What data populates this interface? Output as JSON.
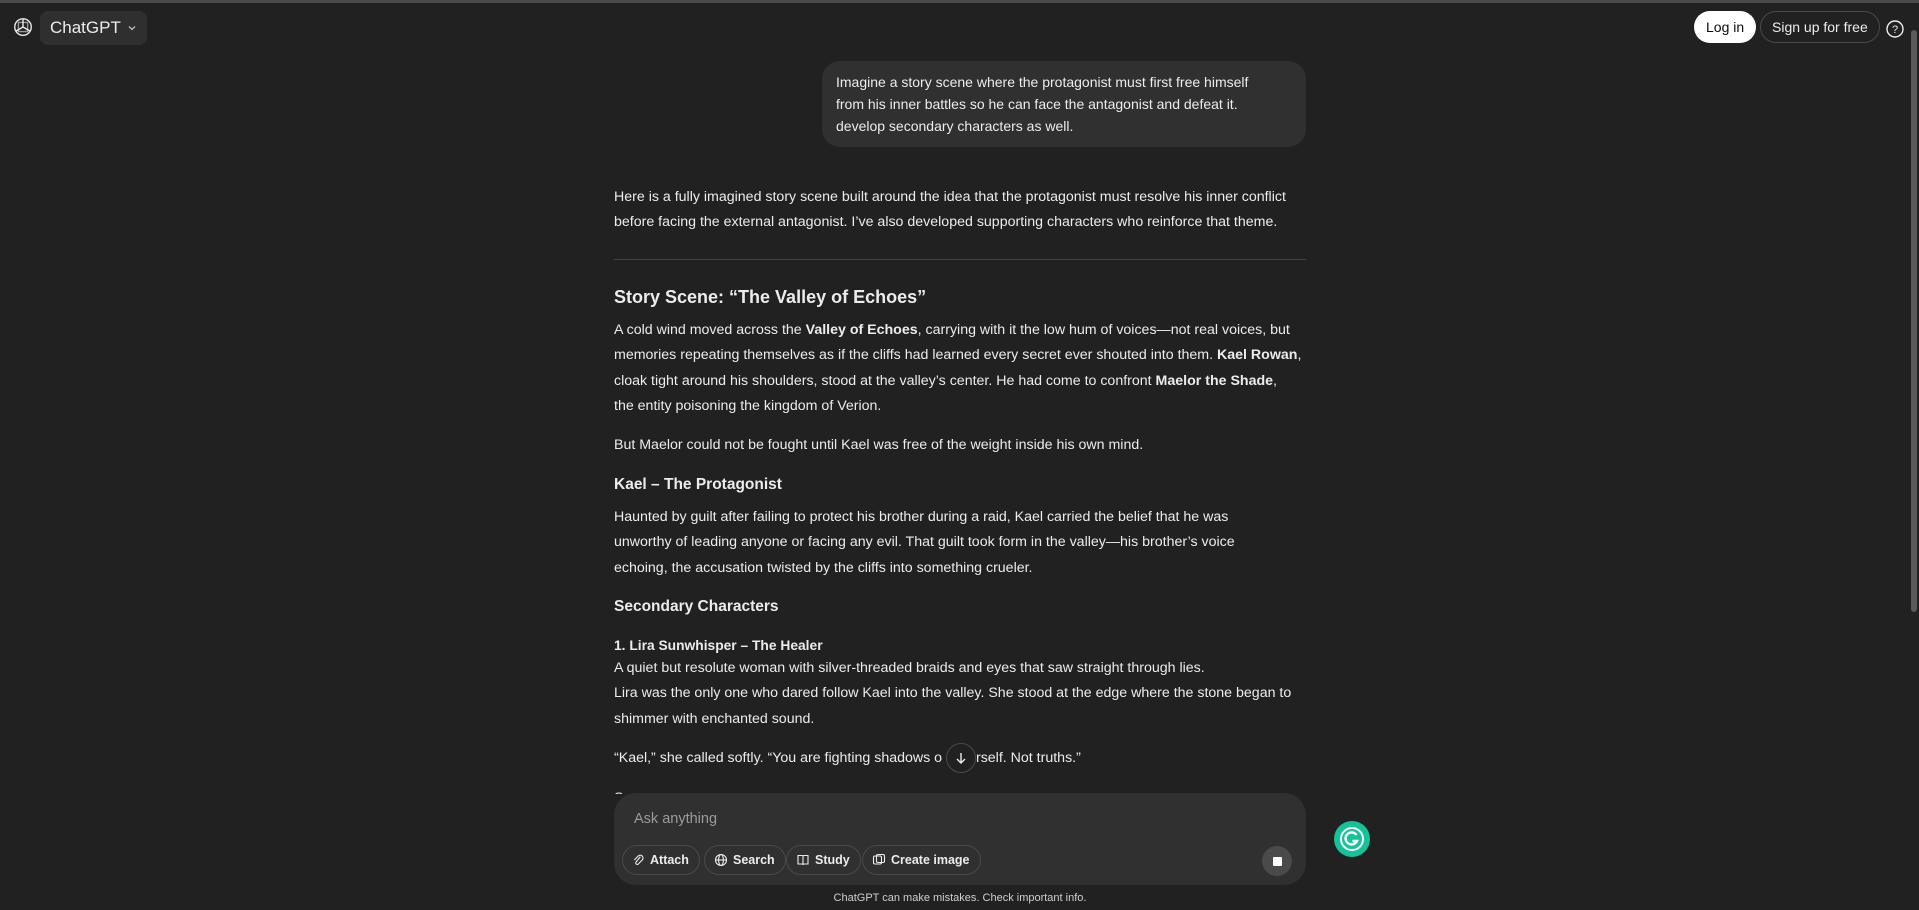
{
  "header": {
    "model_label": "ChatGPT",
    "login_label": "Log in",
    "signup_label": "Sign up for free",
    "help_label": "?"
  },
  "user_message": {
    "lines": [
      "Imagine a story scene where the protagonist must first free himself",
      "from his inner battles so he can face the antagonist and defeat it.",
      "develop secondary characters as well."
    ]
  },
  "assistant": {
    "intro_1": "Here is a fully imagined story scene built around the idea that the protagonist must resolve his inner conflict",
    "intro_2": "before facing the external antagonist. I’ve also developed supporting characters who reinforce that theme.",
    "title": "Story Scene: “The Valley of Echoes”",
    "p1": {
      "a": "A cold wind moved across the ",
      "b": "Valley of Echoes",
      "c": ", carrying with it the low hum of voices—not real voices, but",
      "d": "memories repeating themselves as if the cliffs had learned every secret ever shouted into them. ",
      "e": "Kael Rowan",
      "f": ",",
      "g": "cloak tight around his shoulders, stood at the valley’s center. He had come to confront ",
      "h": "Maelor the Shade",
      "i": ",",
      "j": "the entity poisoning the kingdom of Verion."
    },
    "p2": "But Maelor could not be fought until Kael was free of the weight inside his own mind.",
    "h_kael": "Kael – The Protagonist",
    "p3_1": "Haunted by guilt after failing to protect his brother during a raid, Kael carried the belief that he was",
    "p3_2": "unworthy of leading anyone or facing any evil. That guilt took form in the valley—his brother’s voice",
    "p3_3": "echoing, the accusation twisted by the cliffs into something crueler.",
    "h_secondary": "Secondary Characters",
    "h_lira": "1. Lira Sunwhisper – The Healer",
    "p4_1": "A quiet but resolute woman with silver-threaded braids and eyes that saw straight through lies.",
    "p4_2": "Lira was the only one who dared follow Kael into the valley. She stood at the edge where the stone began to",
    "p4_3": "shimmer with enchanted sound.",
    "p5_a": "“Kael,” she called softly. “You are fighting shadows o",
    "p5_b": "urself. Not truths.”",
    "p6_partial": "S"
  },
  "composer": {
    "placeholder": "Ask anything",
    "attach_label": "Attach",
    "search_label": "Search",
    "study_label": "Study",
    "create_image_label": "Create image"
  },
  "disclaimer": "ChatGPT can make mistakes. Check important info.",
  "colors": {
    "background": "#212121",
    "bubble": "#303030",
    "text": "#ececec",
    "grammarly": "#15c39a"
  }
}
